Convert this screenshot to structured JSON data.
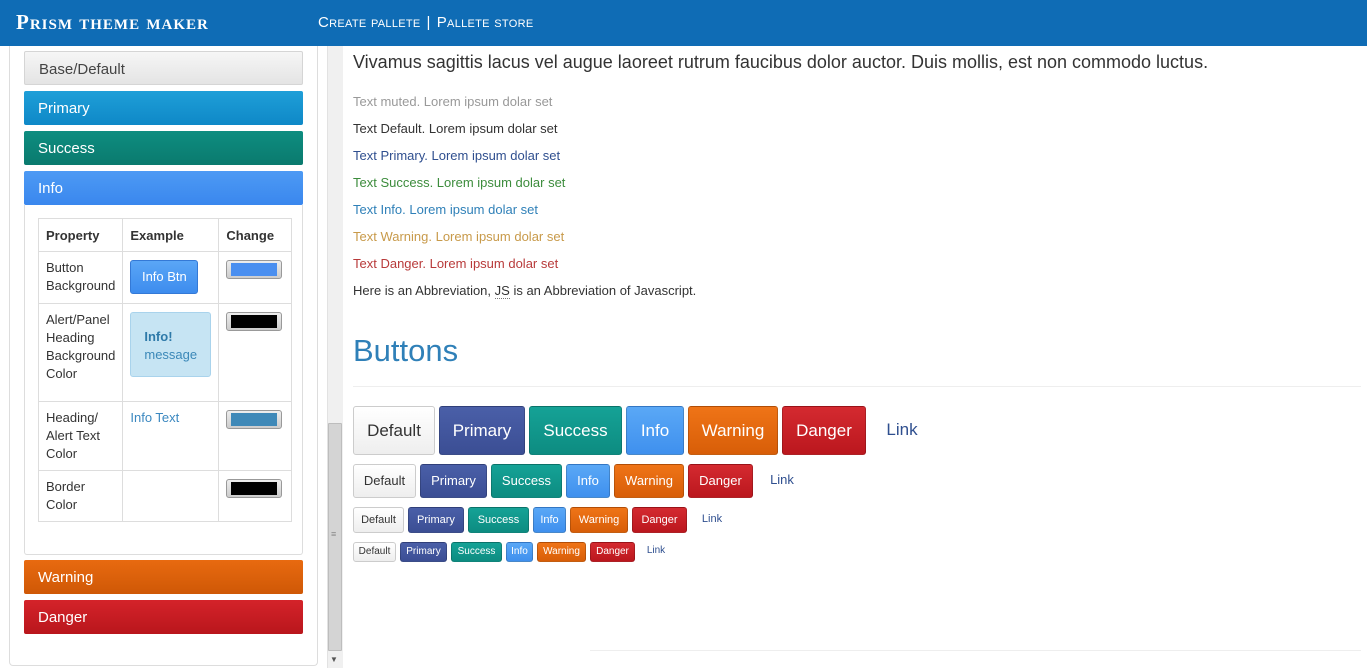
{
  "navbar": {
    "brand": "Prism theme maker",
    "links": [
      "Create pallete",
      "Pallete store"
    ],
    "separator": "|",
    "bg_color": "#0f6cb5"
  },
  "accordion": {
    "base": "Base/Default",
    "primary": "Primary",
    "success": "Success",
    "info": "Info",
    "warning": "Warning",
    "danger": "Danger"
  },
  "props_table": {
    "headers": [
      "Property",
      "Example",
      "Change"
    ],
    "rows": [
      {
        "property": "Button Background",
        "example": "Info Btn",
        "color": "#4a8ff0"
      },
      {
        "property": "Alert/Panel Heading Background Color",
        "example_title": "Info!",
        "example_text": "message",
        "color": "#000000"
      },
      {
        "property": "Heading/ Alert Text Color",
        "example": "Info Text",
        "color": "#3f89b8"
      },
      {
        "property": "Border Color",
        "example": "",
        "color": "#000000"
      }
    ]
  },
  "content": {
    "lead": "Vivamus sagittis lacus vel augue laoreet rutrum faucibus dolor auctor. Duis mollis, est non commodo luctus.",
    "muted": "Text muted. Lorem ipsum dolar set",
    "default": "Text Default. Lorem ipsum dolar set",
    "primary": "Text Primary. Lorem ipsum dolar set",
    "success": "Text Success. Lorem ipsum dolar set",
    "info": "Text Info. Lorem ipsum dolar set",
    "warning": "Text Warning. Lorem ipsum dolar set",
    "danger": "Text Danger. Lorem ipsum dolar set",
    "abbr_pre": "Here is an Abbreviation,",
    "abbr": "JS",
    "abbr_post": "is an Abbreviation of Javascript.",
    "heading": "Buttons"
  },
  "buttons": {
    "default": "Default",
    "primary": "Primary",
    "success": "Success",
    "info": "Info",
    "warning": "Warning",
    "danger": "Danger",
    "link": "Link"
  }
}
